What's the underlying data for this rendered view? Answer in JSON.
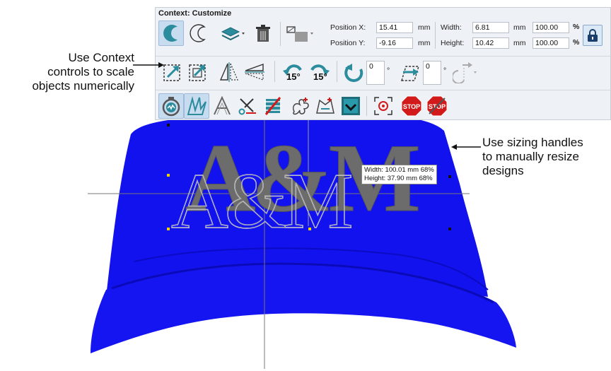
{
  "context": {
    "title": "Context: Customize",
    "position_x_label": "Position X:",
    "position_x_value": "15.41",
    "position_y_label": "Position Y:",
    "position_y_value": "-9.16",
    "width_label": "Width:",
    "width_value": "6.81",
    "height_label": "Height:",
    "height_value": "10.42",
    "unit": "mm",
    "scale_w_value": "100.00",
    "scale_h_value": "100.00",
    "percent": "%",
    "rotate_15_left": "15°",
    "rotate_15_right": "15°",
    "rotate_angle_value": "0",
    "skew_angle_value": "0",
    "degree": "°",
    "stop_label": "STOP"
  },
  "annotations": {
    "left_line1": "Use Context",
    "left_line2": "controls to scale",
    "left_line3": "objects numerically",
    "right_line1": "Use sizing handles",
    "right_line2": "to manually resize",
    "right_line3": "designs"
  },
  "design": {
    "text": "A&M",
    "tooltip_width": "Width: 100.01 mm 68%",
    "tooltip_height": "Height: 37.90 mm 68%"
  },
  "colors": {
    "cap": "#1010f0",
    "embroidery": "#6e6e6e",
    "teal": "#2a8c9c",
    "stop": "#d21a1a"
  }
}
